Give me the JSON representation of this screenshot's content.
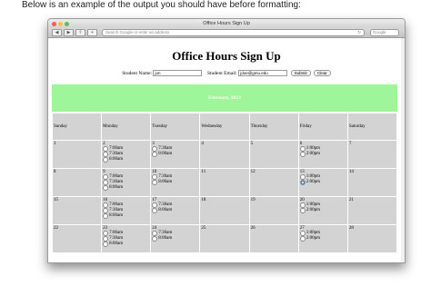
{
  "caption": "Below is an example of the output you should have before formatting:",
  "window": {
    "title": "Office Hours Sign Up"
  },
  "toolbar": {
    "address_placeholder": "Search Google or enter an address",
    "search_placeholder": "Google"
  },
  "page": {
    "heading": "Office Hours Sign Up",
    "name_label": "Student Name:",
    "name_value": "jon",
    "email_label": "Student Email:",
    "email_value": "jdoe@gmu.edu",
    "submit_label": "Submit",
    "clear_label": "Clear",
    "month_title": "February, 2013"
  },
  "calendar": {
    "days": [
      "Sunday",
      "Monday",
      "Tuesday",
      "Wednesday",
      "Thursday",
      "Friday",
      "Saturday"
    ],
    "weeks": [
      [
        {
          "d": "1",
          "s": []
        },
        {
          "d": "2",
          "s": [
            "7:00am",
            "7:30am",
            "8:00am"
          ]
        },
        {
          "d": "3",
          "s": [
            "7:30am",
            "8:00am"
          ]
        },
        {
          "d": "4",
          "s": []
        },
        {
          "d": "5",
          "s": []
        },
        {
          "d": "6",
          "s": [
            "1:00pm",
            "2:00pm"
          ]
        },
        {
          "d": "7",
          "s": []
        }
      ],
      [
        {
          "d": "8",
          "s": []
        },
        {
          "d": "9",
          "s": [
            "7:00am",
            "7:30am",
            "8:00am"
          ]
        },
        {
          "d": "10",
          "s": [
            "7:30am",
            "8:00am"
          ]
        },
        {
          "d": "11",
          "s": []
        },
        {
          "d": "12",
          "s": []
        },
        {
          "d": "13",
          "s": [
            "1:00pm",
            "2:00pm"
          ],
          "sel": 1
        },
        {
          "d": "14",
          "s": []
        }
      ],
      [
        {
          "d": "15",
          "s": []
        },
        {
          "d": "16",
          "s": [
            "7:00am",
            "7:30am",
            "8:00am"
          ]
        },
        {
          "d": "17",
          "s": [
            "7:30am",
            "8:00am"
          ]
        },
        {
          "d": "18",
          "s": []
        },
        {
          "d": "19",
          "s": []
        },
        {
          "d": "20",
          "s": [
            "1:00pm",
            "2:00pm"
          ]
        },
        {
          "d": "21",
          "s": []
        }
      ],
      [
        {
          "d": "22",
          "s": []
        },
        {
          "d": "23",
          "s": [
            "7:00am",
            "7:30am",
            "8:00am"
          ]
        },
        {
          "d": "24",
          "s": [
            "7:30am",
            "8:00am"
          ]
        },
        {
          "d": "25",
          "s": []
        },
        {
          "d": "26",
          "s": []
        },
        {
          "d": "27",
          "s": [
            "1:00pm",
            "2:00pm"
          ]
        },
        {
          "d": "28",
          "s": []
        }
      ]
    ]
  },
  "colors": {
    "month_bar": "#9ef59a",
    "cell": "#d3d3d3"
  }
}
